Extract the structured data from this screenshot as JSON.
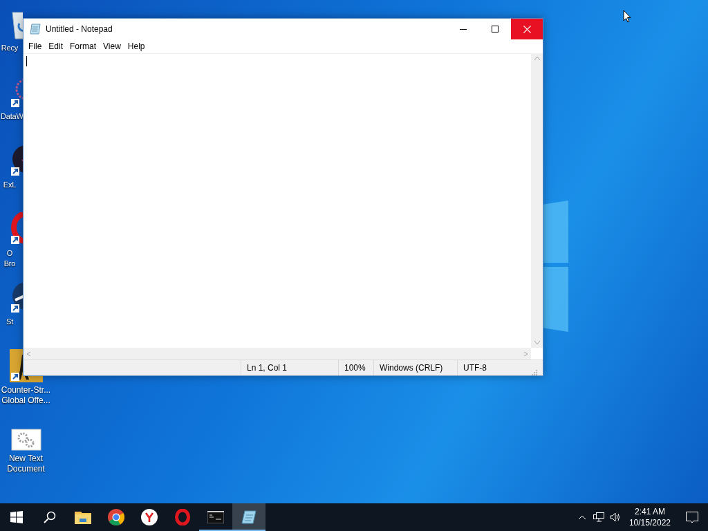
{
  "desktop_icons": [
    {
      "kind": "recycle-bin",
      "lines": [
        "Recy"
      ]
    },
    {
      "kind": "shortcut-app",
      "lines": [
        "DataW"
      ]
    },
    {
      "kind": "dark-app",
      "lines": [
        "ExL"
      ]
    },
    {
      "kind": "opera",
      "lines": [
        "O",
        "Bro"
      ]
    },
    {
      "kind": "steam",
      "lines": [
        "St"
      ]
    },
    {
      "kind": "game",
      "lines": [
        "Counter-Str...",
        "Global Offe..."
      ]
    },
    {
      "kind": "settings-file",
      "lines": [
        "New Text",
        "Document"
      ]
    }
  ],
  "window": {
    "title": "Untitled - Notepad",
    "menu": [
      "File",
      "Edit",
      "Format",
      "View",
      "Help"
    ],
    "status_bar": [
      "Ln 1, Col 1",
      "100%",
      "Windows (CRLF)",
      "UTF-8"
    ]
  },
  "taskbar": {
    "apps": [
      {
        "kind": "start",
        "running": false,
        "active": false
      },
      {
        "kind": "search",
        "running": false,
        "active": false
      },
      {
        "kind": "explorer",
        "running": false,
        "active": false
      },
      {
        "kind": "chrome",
        "running": false,
        "active": false
      },
      {
        "kind": "yandex",
        "running": false,
        "active": false
      },
      {
        "kind": "opera",
        "running": false,
        "active": false
      },
      {
        "kind": "terminal",
        "running": true,
        "active": false
      },
      {
        "kind": "notepad",
        "running": true,
        "active": true
      }
    ],
    "time": "2:41 AM",
    "date": "10/15/2022"
  }
}
